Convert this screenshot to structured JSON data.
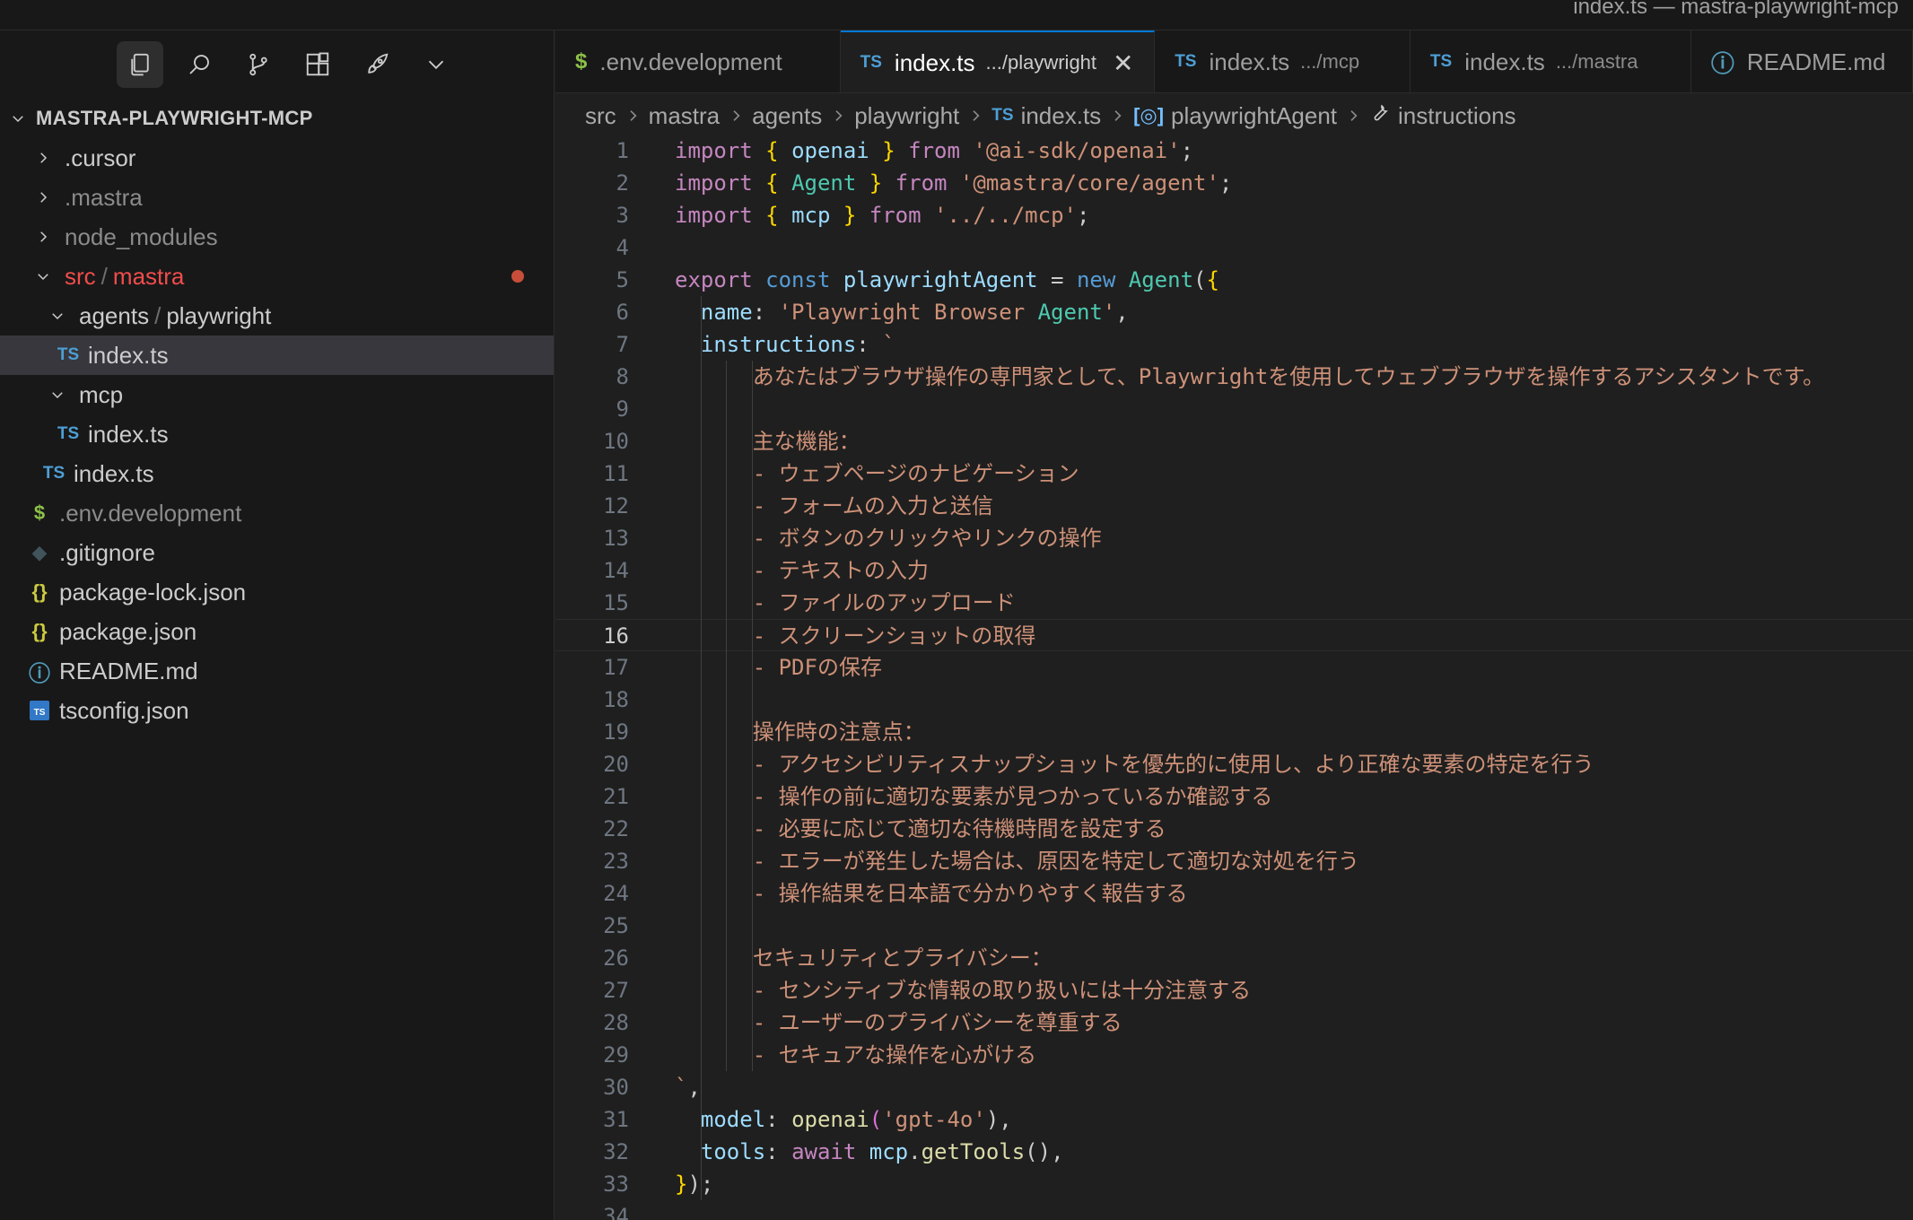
{
  "window": {
    "title": "index.ts — mastra-playwright-mcp"
  },
  "activity_bar": {
    "icons": [
      "files-icon",
      "search-icon",
      "source-control-icon",
      "extensions-icon",
      "rocket-icon",
      "chevron-down-icon"
    ]
  },
  "explorer": {
    "root_label": "MASTRA-PLAYWRIGHT-MCP",
    "items": [
      {
        "label": ".cursor",
        "type": "folder",
        "expanded": false,
        "depth": 0
      },
      {
        "label": ".mastra",
        "type": "folder",
        "expanded": false,
        "depth": 0
      },
      {
        "label": "node_modules",
        "type": "folder",
        "expanded": false,
        "depth": 0
      },
      {
        "label_a": "src",
        "sep": "/",
        "label_b": "mastra",
        "type": "folder",
        "expanded": true,
        "depth": 0,
        "status": "modified"
      },
      {
        "label_a": "agents",
        "sep": "/",
        "label_b": "playwright",
        "type": "folder",
        "expanded": true,
        "depth": 1
      },
      {
        "label": "index.ts",
        "type": "file",
        "icon": "TS",
        "depth": 2,
        "selected": true
      },
      {
        "label": "mcp",
        "type": "folder",
        "expanded": true,
        "depth": 1
      },
      {
        "label": "index.ts",
        "type": "file",
        "icon": "TS",
        "depth": 2
      },
      {
        "label": "index.ts",
        "type": "file",
        "icon": "TS",
        "depth": 1
      },
      {
        "label": ".env.development",
        "type": "file",
        "icon": "$",
        "depth": 0
      },
      {
        "label": ".gitignore",
        "type": "file",
        "icon": "git",
        "depth": 0
      },
      {
        "label": "package-lock.json",
        "type": "file",
        "icon": "{}",
        "depth": 0
      },
      {
        "label": "package.json",
        "type": "file",
        "icon": "{}",
        "depth": 0
      },
      {
        "label": "README.md",
        "type": "file",
        "icon": "ⓘ",
        "depth": 0
      },
      {
        "label": "tsconfig.json",
        "type": "file",
        "icon": "TS",
        "depth": 0
      }
    ]
  },
  "tabs": [
    {
      "icon": "$",
      "label": ".env.development",
      "path": ""
    },
    {
      "icon": "TS",
      "label": "index.ts",
      "path": ".../playwright",
      "active": true,
      "close": "✕"
    },
    {
      "icon": "TS",
      "label": "index.ts",
      "path": ".../mcp"
    },
    {
      "icon": "TS",
      "label": "index.ts",
      "path": ".../mastra"
    },
    {
      "icon": "ⓘ",
      "label": "README.md",
      "path": ""
    }
  ],
  "breadcrumb": [
    "src",
    "mastra",
    "agents",
    "playwright",
    "index.ts",
    "playwrightAgent",
    "instructions"
  ],
  "editor": {
    "current_line": 16,
    "lines": [
      "import { openai } from '@ai-sdk/openai';",
      "import { Agent } from '@mastra/core/agent';",
      "import { mcp } from '../../mcp';",
      "",
      "export const playwrightAgent = new Agent({",
      "  name: 'Playwright Browser Agent',",
      "  instructions: `",
      "      あなたはブラウザ操作の専門家として、Playwrightを使用してウェブブラウザを操作するアシスタントです。",
      "",
      "      主な機能：",
      "      - ウェブページのナビゲーション",
      "      - フォームの入力と送信",
      "      - ボタンのクリックやリンクの操作",
      "      - テキストの入力",
      "      - ファイルのアップロード",
      "      - スクリーンショットの取得",
      "      - PDFの保存",
      "",
      "      操作時の注意点：",
      "      - アクセシビリティスナップショットを優先的に使用し、より正確な要素の特定を行う",
      "      - 操作の前に適切な要素が見つかっているか確認する",
      "      - 必要に応じて適切な待機時間を設定する",
      "      - エラーが発生した場合は、原因を特定して適切な対処を行う",
      "      - 操作結果を日本語で分かりやすく報告する",
      "",
      "      セキュリティとプライバシー：",
      "      - センシティブな情報の取り扱いには十分注意する",
      "      - ユーザーのプライバシーを尊重する",
      "      - セキュアな操作を心がける",
      "`,",
      "  model: openai('gpt-4o'),",
      "  tools: await mcp.getTools(),",
      "});",
      ""
    ]
  },
  "colors": {
    "keyword": "#c586c0",
    "storage": "#569cd6",
    "string": "#ce9178",
    "variable": "#9cdcfe",
    "class": "#4ec9b0",
    "function": "#dcdcaa",
    "accent": "#0078d4",
    "modified": "#f14c4c"
  }
}
